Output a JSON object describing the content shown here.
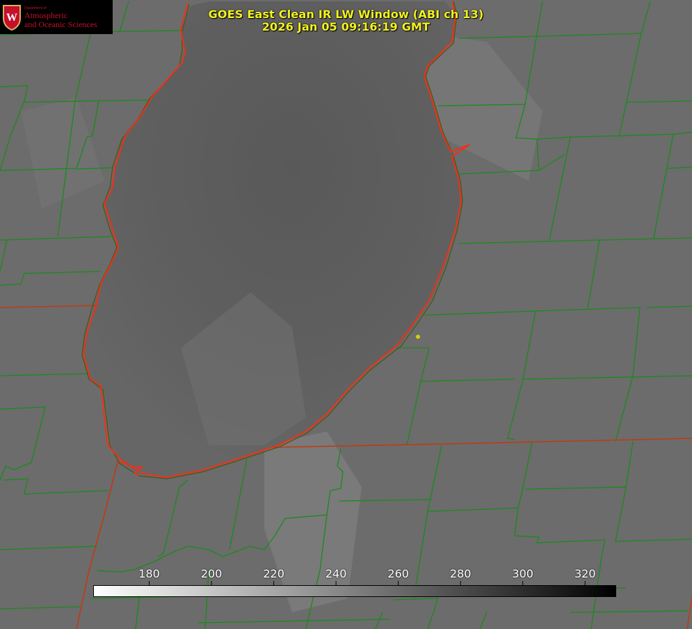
{
  "title": {
    "line1": "GOES East Clean IR LW Window (ABI ch 13)",
    "line2": "2026 Jan 05 09:16:19 GMT"
  },
  "logo": {
    "small_text": "Department of",
    "line1": "Atmospheric",
    "line2": "and Oceanic Sciences",
    "shield_letter": "W",
    "icon": "uw-crest-icon"
  },
  "colorbar": {
    "ticks": [
      {
        "label": "180",
        "value": 180
      },
      {
        "label": "200",
        "value": 200
      },
      {
        "label": "220",
        "value": 220
      },
      {
        "label": "240",
        "value": 240
      },
      {
        "label": "260",
        "value": 260
      },
      {
        "label": "280",
        "value": 280
      },
      {
        "label": "300",
        "value": 300
      },
      {
        "label": "320",
        "value": 320
      }
    ],
    "range": [
      162,
      330
    ],
    "gradient": [
      "#ffffff",
      "#000000"
    ]
  },
  "colors": {
    "title": "#f2f21e",
    "county_lines": "#1a8a1a",
    "lake_outline": "#ff2a10",
    "state_lines": "#c83a10",
    "marker": "#d4d000",
    "logo_red": "#c5102b"
  }
}
